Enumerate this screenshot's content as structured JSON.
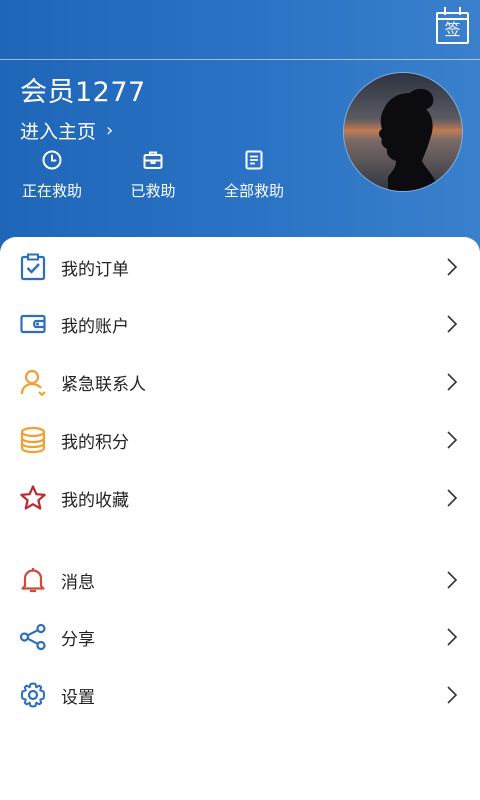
{
  "header": {
    "sign_label": "签",
    "username": "会员1277",
    "homepage_label": "进入主页",
    "homepage_chevron": "›",
    "stats": [
      {
        "label": "正在救助",
        "icon": "clock-icon"
      },
      {
        "label": "已救助",
        "icon": "briefcase-icon"
      },
      {
        "label": "全部救助",
        "icon": "document-icon"
      }
    ]
  },
  "menu": {
    "group1": [
      {
        "label": "我的订单",
        "icon": "clipboard-check-icon",
        "color": "#2d6fbd"
      },
      {
        "label": "我的账户",
        "icon": "wallet-icon",
        "color": "#2d6fbd"
      },
      {
        "label": "紧急联系人",
        "icon": "person-icon",
        "color": "#f0a030"
      },
      {
        "label": "我的积分",
        "icon": "database-icon",
        "color": "#f0a030"
      },
      {
        "label": "我的收藏",
        "icon": "star-icon",
        "color": "#c0282f"
      }
    ],
    "group2": [
      {
        "label": "消息",
        "icon": "bell-icon",
        "color": "#d04a3a"
      },
      {
        "label": "分享",
        "icon": "share-icon",
        "color": "#2d6fbd"
      },
      {
        "label": "设置",
        "icon": "gear-icon",
        "color": "#2d6fbd"
      }
    ]
  },
  "colors": {
    "header_blue": "#2b73c4",
    "text_dark": "#222222"
  }
}
